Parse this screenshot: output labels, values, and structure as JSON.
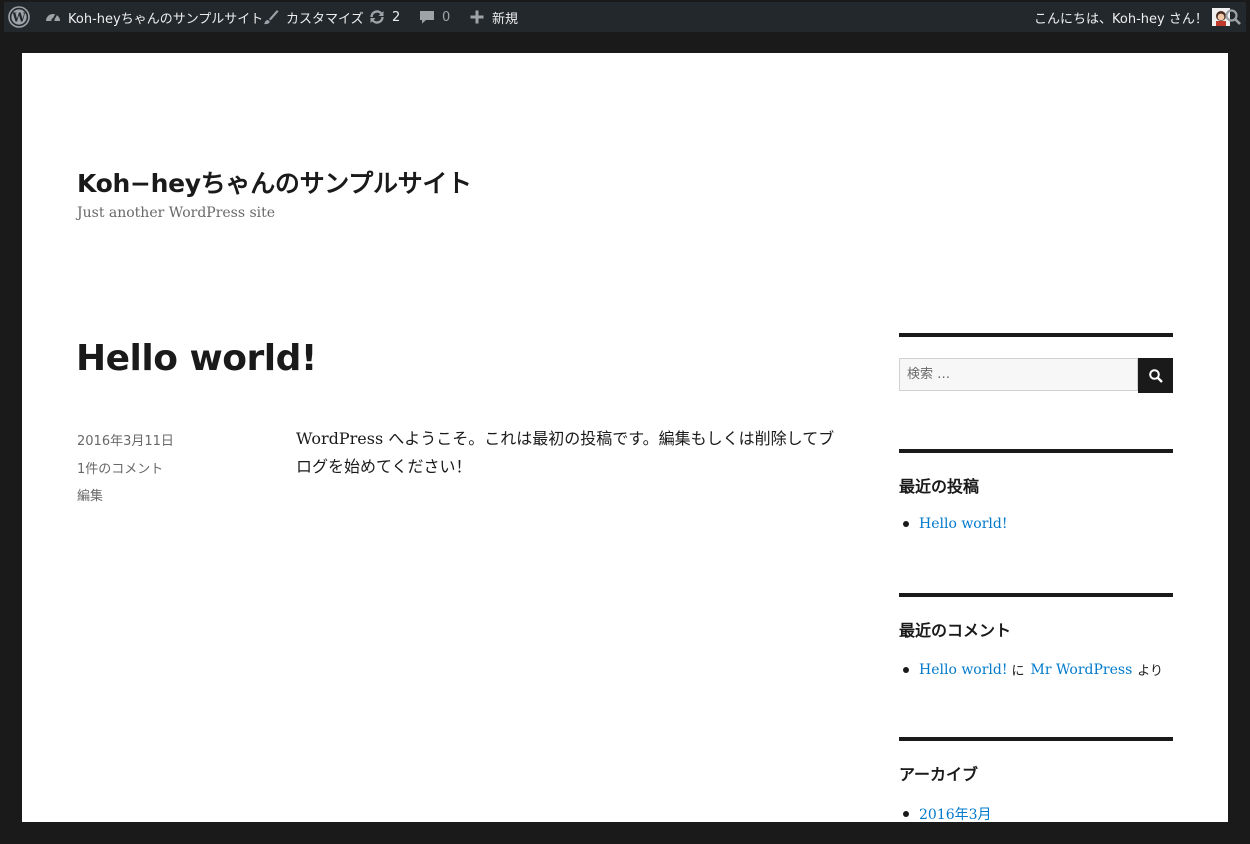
{
  "adminbar": {
    "site_name": "Koh-heyちゃんのサンプルサイト",
    "customize_label": "カスタマイズ",
    "updates_count": "2",
    "comments_count": "0",
    "new_label": "新規",
    "greeting": "こんにちは、Koh-hey さん！",
    "icons": [
      "wordpress-logo-icon",
      "dashboard-icon",
      "brush-icon",
      "updates-icon",
      "comment-icon",
      "plus-icon",
      "avatar",
      "search-icon"
    ]
  },
  "site": {
    "title": "Koh−heyちゃんのサンプルサイト",
    "description": "Just another WordPress site"
  },
  "post": {
    "title": "Hello world!",
    "date": "2016年3月11日",
    "comments_link": "1件のコメント",
    "edit_link": "編集",
    "content": "WordPress へようこそ。これは最初の投稿です。編集もしくは削除してブログを始めてください！"
  },
  "sidebar": {
    "search": {
      "placeholder": "検索 …"
    },
    "recent_posts": {
      "title": "最近の投稿",
      "items": [
        "Hello world!"
      ]
    },
    "recent_comments": {
      "title": "最近のコメント",
      "items": [
        {
          "post": "Hello world!",
          "connector": "に",
          "author": "Mr WordPress",
          "suffix": "より"
        }
      ]
    },
    "archives": {
      "title": "アーカイブ",
      "items": [
        "2016年3月"
      ]
    }
  },
  "colors": {
    "link": "#007acc",
    "adminbar": "#23282d",
    "text": "#1a1a1a",
    "meta": "#686868"
  }
}
